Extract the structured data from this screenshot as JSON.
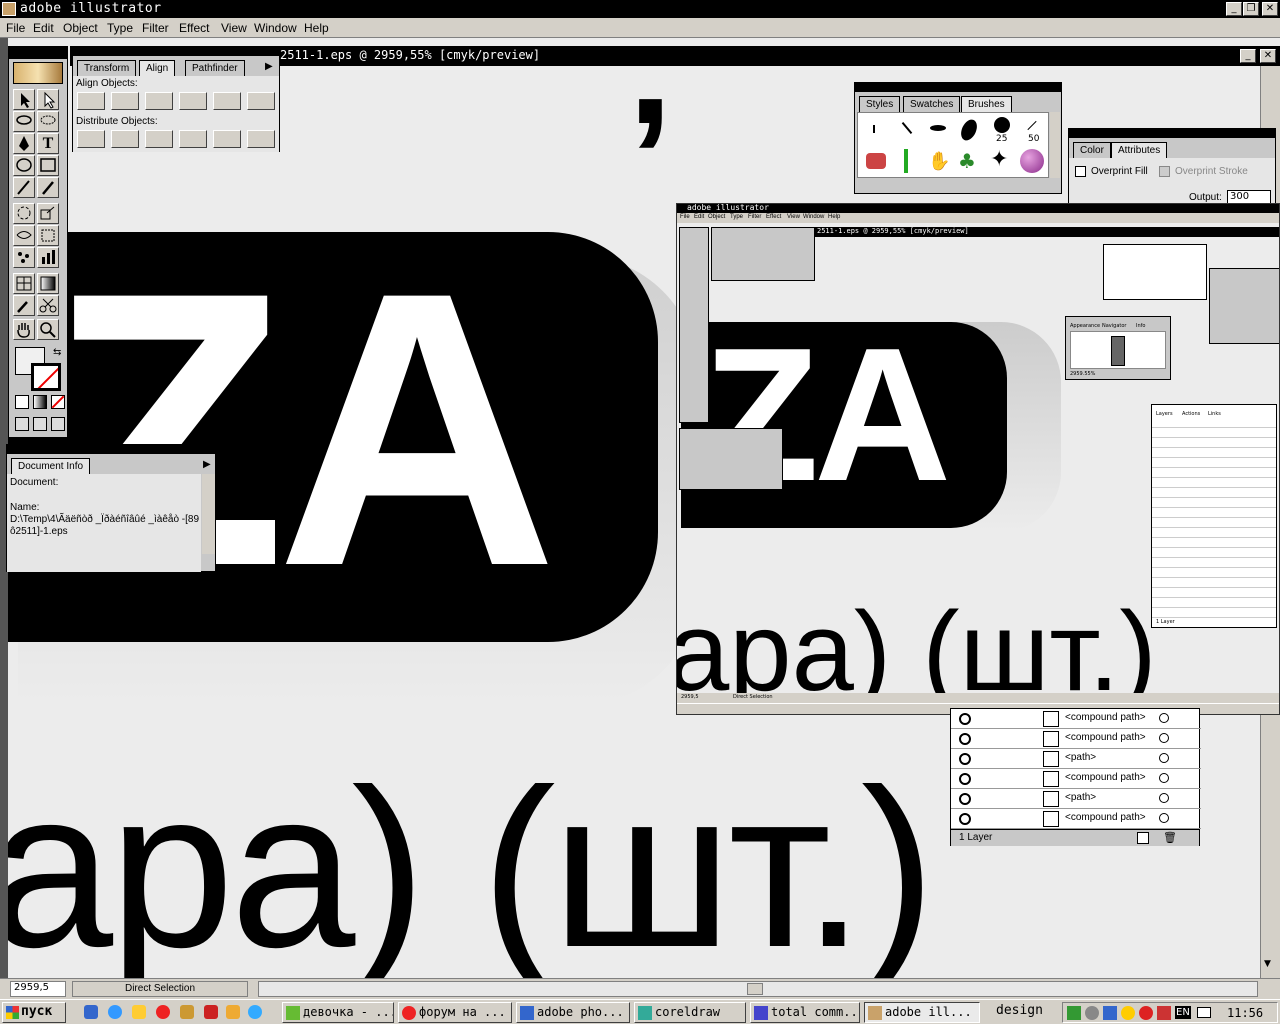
{
  "window": {
    "title": "adobe illustrator",
    "doc_title": "2511-1.eps @ 2959,55% [cmyk/preview]"
  },
  "menu": [
    "File",
    "Edit",
    "Object",
    "Type",
    "Filter",
    "Effect",
    "View",
    "Window",
    "Help"
  ],
  "align_panel": {
    "tabs": [
      "Transform",
      "Align",
      "Pathfinder"
    ],
    "align_label": "Align Objects:",
    "distribute_label": "Distribute Objects:"
  },
  "brushes_panel": {
    "tabs": [
      "Styles",
      "Swatches",
      "Brushes"
    ],
    "sizes": [
      "25",
      "50"
    ]
  },
  "attributes_panel": {
    "tabs": [
      "Color",
      "Attributes"
    ],
    "overprint_fill": "Overprint Fill",
    "overprint_stroke": "Overprint Stroke",
    "output_label": "Output:",
    "output_value": "300"
  },
  "docinfo_panel": {
    "tab": "Document Info",
    "line1": "Document:",
    "line2": "Name:",
    "line3": "D:\\Temp\\4\\Ãäëñòð _Ïðàéñîâûé _ìàêåò -[89",
    "line4": "ô2511]-1.eps"
  },
  "canvas": {
    "big_letters": "ZA",
    "bottom_text": "ара) (шт.)"
  },
  "layers_panel": {
    "rows": [
      "<compound path>",
      "<compound path>",
      "<path>",
      "<compound path>",
      "<path>",
      "<compound path>"
    ],
    "footer": "1 Layer"
  },
  "status": {
    "zoom": "2959,5",
    "tool": "Direct Selection"
  },
  "nested": {
    "title": "adobe illustrator",
    "doc_title": "2511-1.eps @ 2959,55% [cmyk/preview]",
    "menu": [
      "File",
      "Edit",
      "Object",
      "Type",
      "Filter",
      "Effect",
      "View",
      "Window",
      "Help"
    ],
    "nav_tabs": [
      "Appearance",
      "Navigator",
      "Info"
    ],
    "nav_zoom": "2959.55%",
    "layers_tabs": [
      "Layers",
      "Actions",
      "Links"
    ],
    "layers_footer": "1 Layer",
    "zoom": "2959,5",
    "tool": "Direct Selection"
  },
  "taskbar": {
    "start": "пуск",
    "tasks": [
      "девочка - ...",
      "форум на ...",
      "adobe pho...",
      "coreldraw",
      "total comm...",
      "adobe ill..."
    ],
    "tray_label": "design",
    "lang": "EN",
    "clock": "11:56"
  }
}
